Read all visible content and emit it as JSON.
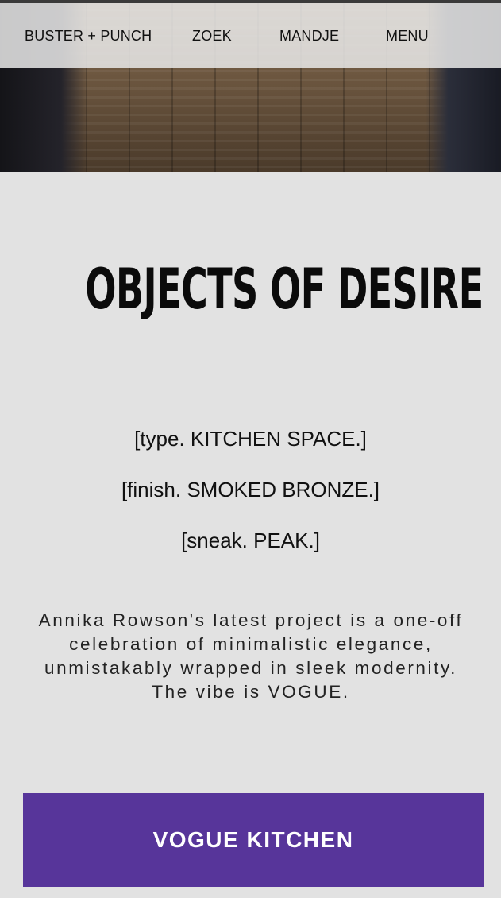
{
  "nav": {
    "brand": "BUSTER + PUNCH",
    "search": "ZOEK",
    "cart": "MANDJE",
    "menu": "MENU"
  },
  "main": {
    "title": "OBJECTS OF DESIRE",
    "specs": [
      "[type. KITCHEN SPACE.]",
      "[finish. SMOKED BRONZE.]",
      "[sneak. PEAK.]"
    ],
    "description": "Annika Rowson's latest project is a one-off celebration of minimalistic elegance, unmistakably wrapped in sleek modernity. The vibe is VOGUE.",
    "cta_label": "VOGUE KITCHEN"
  },
  "colors": {
    "background": "#e2e2e2",
    "accent": "#57359a",
    "text": "#111111"
  }
}
